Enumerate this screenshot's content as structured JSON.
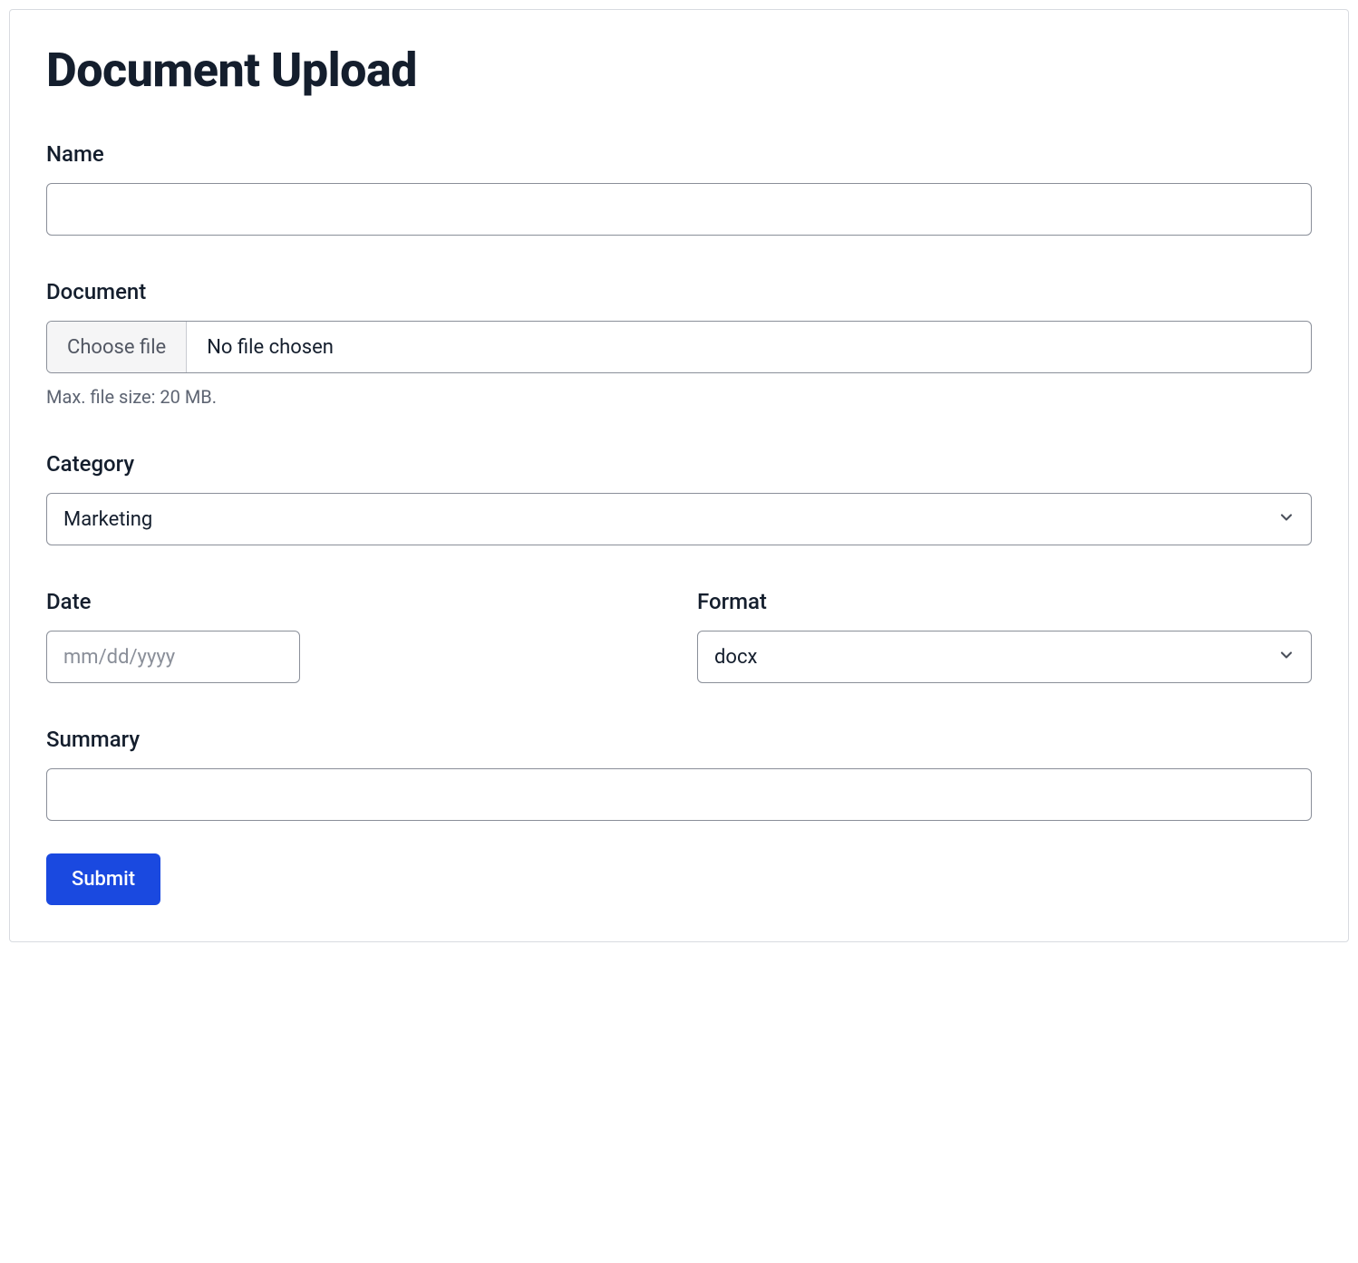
{
  "title": "Document Upload",
  "fields": {
    "name": {
      "label": "Name",
      "value": ""
    },
    "document": {
      "label": "Document",
      "button_label": "Choose file",
      "status": "No file chosen",
      "help": "Max. file size: 20 MB."
    },
    "category": {
      "label": "Category",
      "value": "Marketing"
    },
    "date": {
      "label": "Date",
      "placeholder": "mm/dd/yyyy",
      "value": ""
    },
    "format": {
      "label": "Format",
      "value": "docx"
    },
    "summary": {
      "label": "Summary",
      "value": ""
    }
  },
  "submit_label": "Submit"
}
